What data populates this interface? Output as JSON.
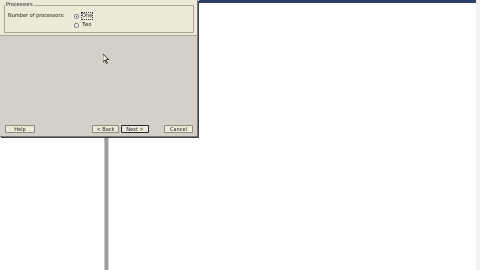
{
  "dialog": {
    "group_title": "Processors",
    "field_label": "Number of processors:",
    "options": [
      {
        "label": "One",
        "selected": true
      },
      {
        "label": "Two",
        "selected": false
      }
    ]
  },
  "buttons": {
    "help": "Help",
    "back": "< Back",
    "next": "Next >",
    "cancel": "Cancel"
  },
  "icons": {
    "pointer": "mouse-pointer-icon"
  },
  "colors": {
    "dialog_face": "#d4d0c8",
    "header_face": "#ece9d8",
    "titlebar_blue": "#2f3f69"
  }
}
